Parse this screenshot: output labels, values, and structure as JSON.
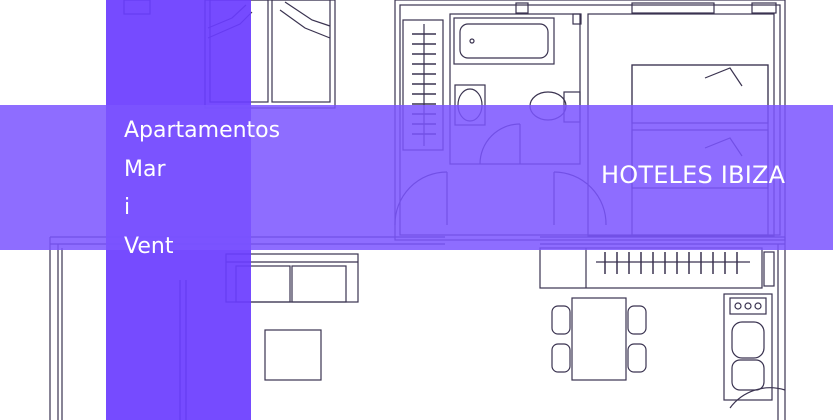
{
  "title_lines": [
    "Apartamentos",
    "Mar",
    "i",
    "Vent"
  ],
  "brand": "HOTELES IBIZA",
  "colors": {
    "band_vertical": "#6a3cff",
    "band_horizontal": "#7b55ff",
    "plan_lines": "#3a3350",
    "text": "#ffffff"
  }
}
